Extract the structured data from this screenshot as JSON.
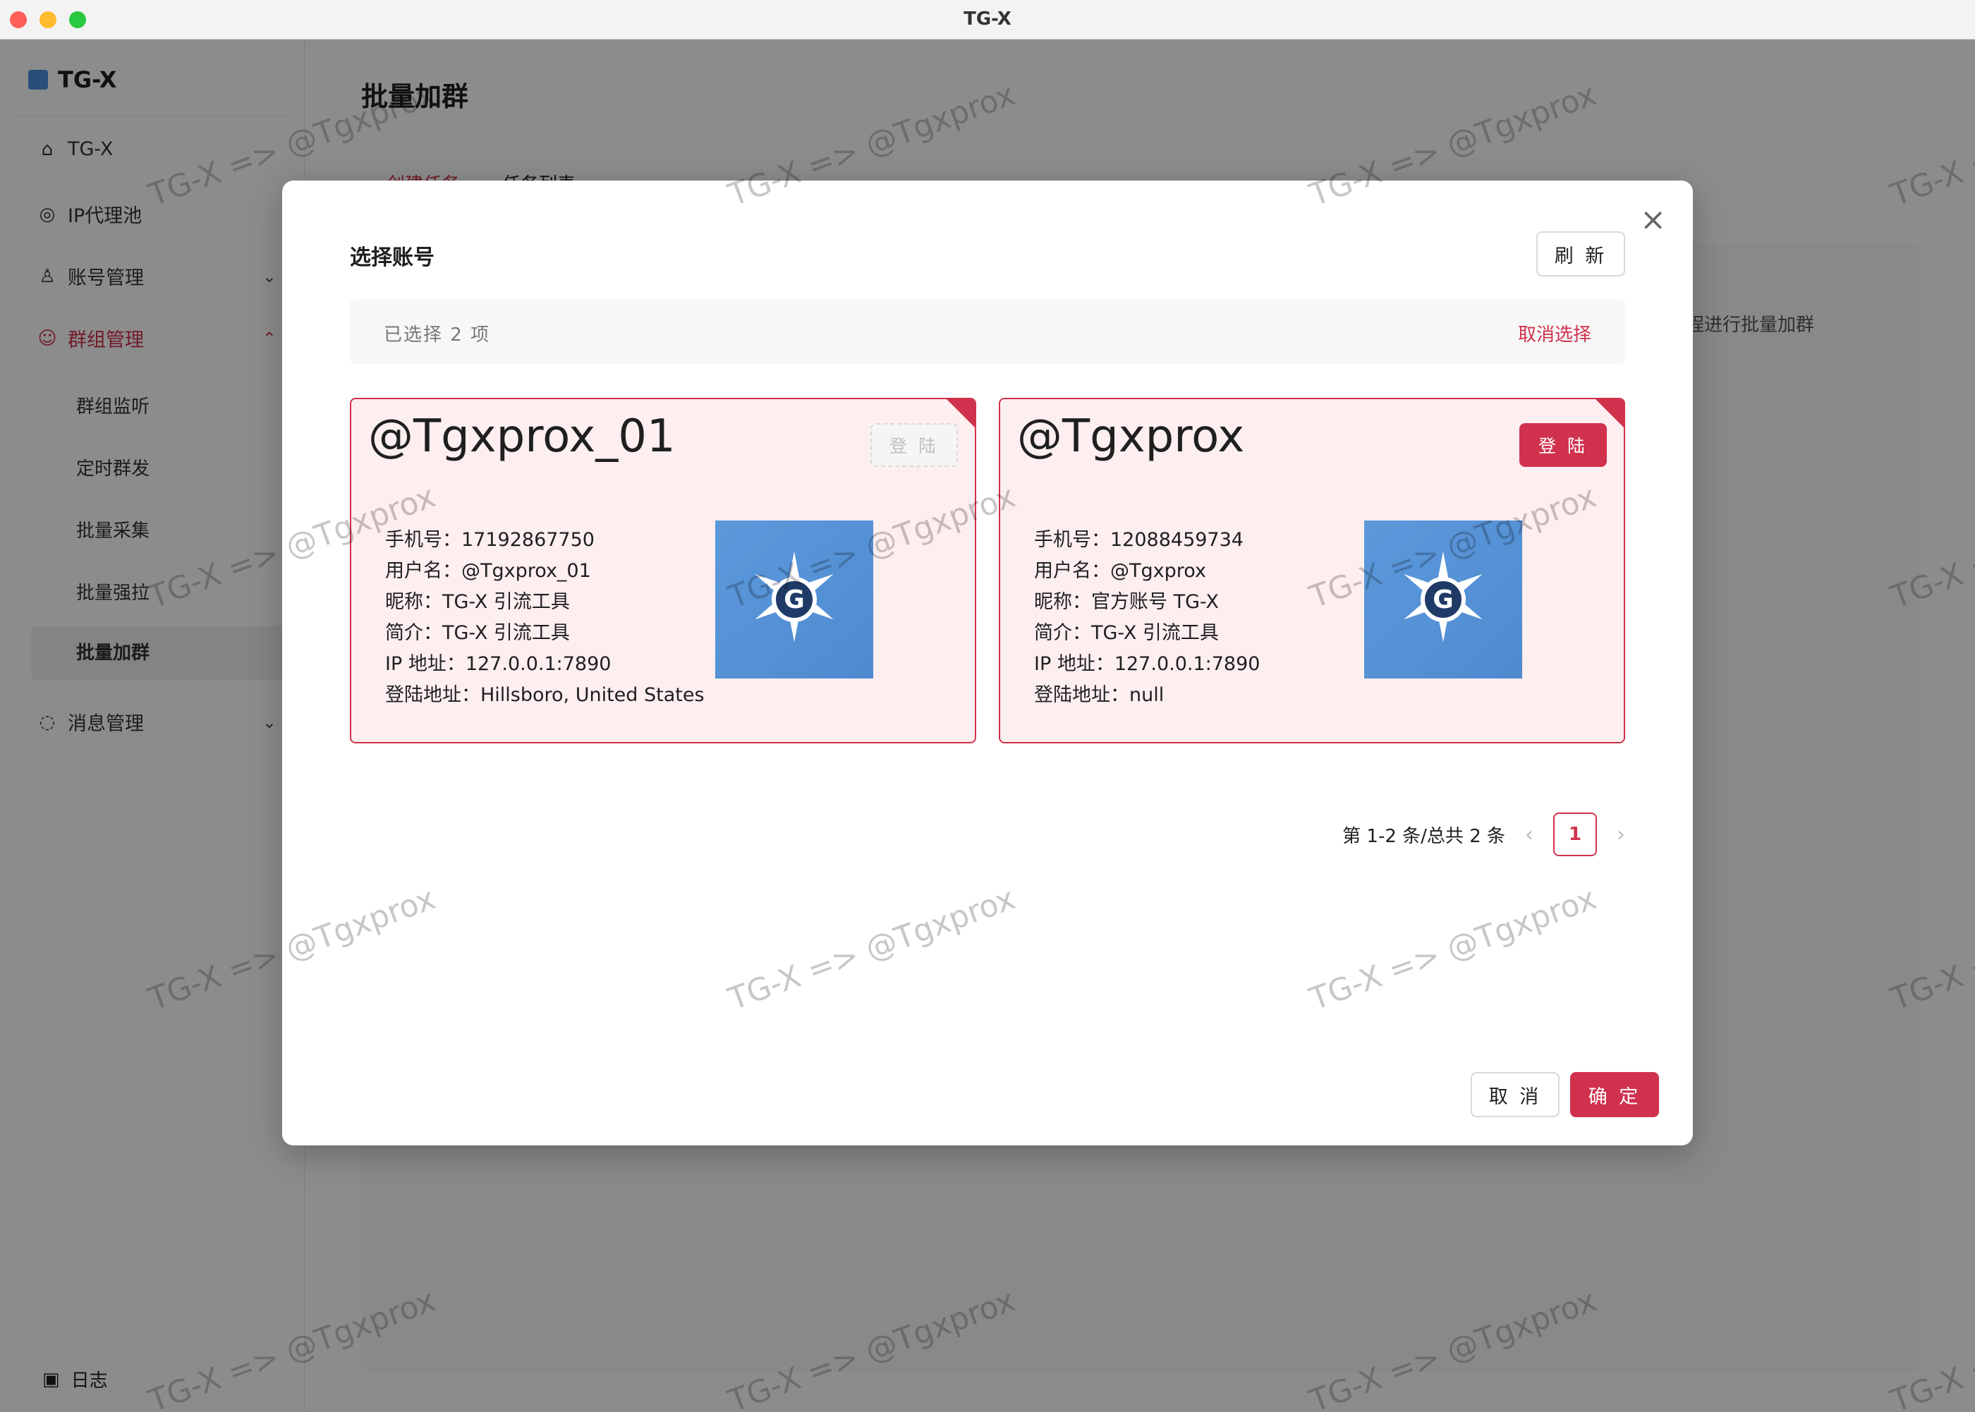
{
  "window": {
    "title": "TG-X"
  },
  "sidebar": {
    "brand": "TG-X",
    "items": [
      {
        "label": "TG-X",
        "icon": "home-icon"
      },
      {
        "label": "IP代理池",
        "icon": "globe-icon"
      },
      {
        "label": "账号管理",
        "icon": "user-icon"
      },
      {
        "label": "群组管理",
        "icon": "group-icon"
      },
      {
        "label": "消息管理",
        "icon": "message-icon"
      }
    ],
    "sub_items": [
      "群组监听",
      "定时群发",
      "批量采集",
      "批量强拉",
      "批量加群"
    ],
    "log": "日志"
  },
  "page": {
    "title": "批量加群",
    "tabs": [
      "创建任务",
      "任务列表"
    ],
    "hint": "程进行批量加群"
  },
  "watermark": "TG-X => @Tgxprox",
  "modal": {
    "title": "选择账号",
    "refresh": "刷 新",
    "selected_text": "已选择  2  项",
    "clear": "取消选择",
    "cards": [
      {
        "name": "@Tgxprox_01",
        "login": "登 陆",
        "login_enabled": false,
        "phone": "手机号：17192867750",
        "username": "用户名：@Tgxprox_01",
        "nickname": "昵称：TG-X 引流工具",
        "bio": "简介：TG-X 引流工具",
        "ip": "IP 地址：127.0.0.1:7890",
        "location": "登陆地址：Hillsboro, United States"
      },
      {
        "name": "@Tgxprox",
        "login": "登 陆",
        "login_enabled": true,
        "phone": "手机号：12088459734",
        "username": "用户名：@Tgxprox",
        "nickname": "昵称：官方账号 TG-X",
        "bio": "简介：TG-X 引流工具",
        "ip": "IP 地址：127.0.0.1:7890",
        "location": "登陆地址：null"
      }
    ],
    "pager": {
      "summary": "第 1-2 条/总共 2 条",
      "current": "1",
      "prev": "‹",
      "next": "›"
    },
    "cancel": "取 消",
    "confirm": "确 定",
    "close": "×"
  },
  "colors": {
    "accent": "#d0324d",
    "card_bg": "#fdeef0"
  }
}
